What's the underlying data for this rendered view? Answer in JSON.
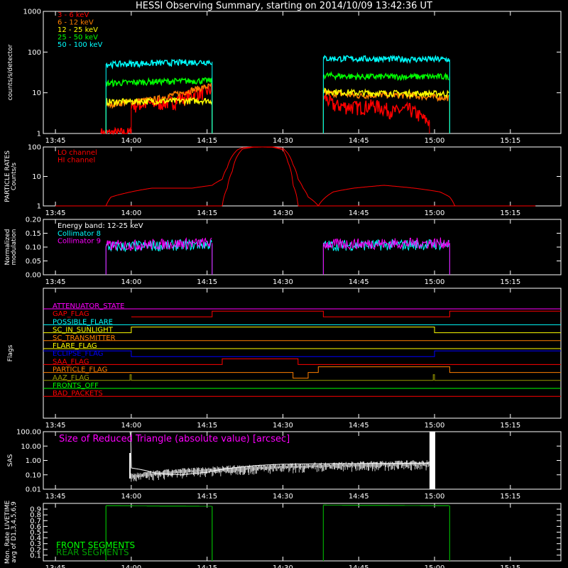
{
  "title": "HESSI Observing Summary, starting on 2014/10/09 13:42:36 UT",
  "colors": {
    "bg": "#000000",
    "axis": "#ffffff",
    "red": "#ff0000",
    "orange": "#ff7f00",
    "yellow": "#ffff00",
    "green": "#00ff00",
    "cyan": "#00ffff",
    "magenta": "#ff00ff",
    "blue": "#0000ff",
    "olive": "#9a9a00",
    "darkgreen": "#00a000",
    "white": "#ffffff"
  },
  "chart_data": [
    {
      "type": "line",
      "ylabel": "counts/s/detector",
      "yscale": "log",
      "ylim": [
        1,
        1000
      ],
      "yticks": [
        "1",
        "10",
        "100",
        "1000"
      ],
      "xlim": [
        "13:42:36",
        "15:25"
      ],
      "xticks": [
        "13:45",
        "14:00",
        "14:15",
        "14:30",
        "14:45",
        "15:00",
        "15:15"
      ],
      "series": [
        {
          "name": "3 - 6 keV",
          "color": "#ff0000",
          "segments": [
            {
              "x": [
                "13:54",
                "14:00"
              ],
              "y": [
                1,
                1
              ]
            },
            {
              "x": [
                "14:00",
                "14:04",
                "14:08",
                "14:12",
                "14:16"
              ],
              "y": [
                5,
                5.5,
                6,
                9,
                12
              ]
            },
            {
              "x": [
                "14:38",
                "14:40",
                "14:45",
                "14:48",
                "14:52",
                "14:55",
                "14:58",
                "14:59"
              ],
              "y": [
                8,
                5,
                4.5,
                5,
                3.5,
                4,
                2.2,
                2
              ]
            }
          ]
        },
        {
          "name": "6 - 12 keV",
          "color": "#ff7f00",
          "segments": [
            {
              "x": [
                "13:55",
                "14:05",
                "14:10",
                "14:16"
              ],
              "y": [
                5,
                7,
                10,
                15
              ]
            },
            {
              "x": [
                "14:38",
                "14:45",
                "14:50",
                "15:03"
              ],
              "y": [
                10,
                8.5,
                9,
                7.5
              ]
            }
          ]
        },
        {
          "name": "12 - 25 keV",
          "color": "#ffff00",
          "segments": [
            {
              "x": [
                "13:55",
                "14:16"
              ],
              "y": [
                6,
                6.5
              ]
            },
            {
              "x": [
                "14:38",
                "14:45",
                "15:03"
              ],
              "y": [
                11,
                10,
                9.5
              ]
            }
          ]
        },
        {
          "name": "25 - 50 keV",
          "color": "#00ff00",
          "segments": [
            {
              "x": [
                "13:55",
                "14:05",
                "14:16"
              ],
              "y": [
                17,
                19,
                20
              ]
            },
            {
              "x": [
                "14:38",
                "14:45",
                "15:03"
              ],
              "y": [
                27,
                25,
                25
              ]
            }
          ]
        },
        {
          "name": "50 - 100 keV",
          "color": "#00ffff",
          "segments": [
            {
              "x": [
                "13:55",
                "14:16"
              ],
              "y": [
                50,
                58
              ]
            },
            {
              "x": [
                "14:38",
                "15:03"
              ],
              "y": [
                70,
                66
              ]
            }
          ]
        }
      ]
    },
    {
      "type": "line",
      "ylabel": "PARTICLE RATES Counts/s",
      "yscale": "log",
      "ylim": [
        1,
        100
      ],
      "yticks": [
        "1",
        "10",
        "100"
      ],
      "xticks": [
        "13:45",
        "14:00",
        "14:15",
        "14:30",
        "14:45",
        "15:00",
        "15:15"
      ],
      "series": [
        {
          "name": "LO channel",
          "color": "#ff0000",
          "x": [
            "13:45",
            "13:55",
            "13:56",
            "14:00",
            "14:04",
            "14:08",
            "14:12",
            "14:16",
            "14:18",
            "14:19",
            "14:20",
            "14:21",
            "14:22",
            "14:24",
            "14:26",
            "14:28",
            "14:30",
            "14:31",
            "14:32",
            "14:33",
            "14:34",
            "14:35",
            "14:37",
            "14:40",
            "14:44",
            "14:50",
            "14:56",
            "15:01",
            "15:03",
            "15:04",
            "15:20"
          ],
          "y": [
            1,
            1,
            2,
            3,
            4,
            4,
            4,
            5,
            8,
            20,
            50,
            80,
            95,
            100,
            100,
            100,
            90,
            60,
            25,
            8,
            4,
            2,
            1,
            3,
            4,
            5,
            4,
            3,
            2,
            1,
            1
          ]
        },
        {
          "name": "HI channel",
          "color": "#ff0000",
          "x": [
            "13:45",
            "14:18",
            "14:19",
            "14:20",
            "14:21",
            "14:22",
            "14:24",
            "14:26",
            "14:28",
            "14:30",
            "14:31",
            "14:32",
            "14:33",
            "15:20"
          ],
          "y": [
            1,
            1,
            4,
            15,
            50,
            85,
            98,
            100,
            98,
            80,
            30,
            5,
            1,
            1
          ]
        }
      ]
    },
    {
      "type": "line",
      "ylabel": "Normalized modulation",
      "ylim": [
        0,
        0.2
      ],
      "yticks": [
        "0.00",
        "0.05",
        "0.10",
        "0.15",
        "0.20"
      ],
      "xticks": [
        "13:45",
        "14:00",
        "14:15",
        "14:30",
        "14:45",
        "15:00",
        "15:15"
      ],
      "annotation": "Energy band: 12-25 keV",
      "series": [
        {
          "name": "Collimator 8",
          "color": "#00ffff",
          "segments": [
            {
              "x": [
                "13:55",
                "14:16"
              ],
              "y": [
                0.1,
                0.11
              ]
            },
            {
              "x": [
                "14:38",
                "15:03"
              ],
              "y": [
                0.105,
                0.11
              ]
            }
          ]
        },
        {
          "name": "Collimator 9",
          "color": "#ff00ff",
          "segments": [
            {
              "x": [
                "13:55",
                "14:16"
              ],
              "y": [
                0.105,
                0.115
              ]
            },
            {
              "x": [
                "14:38",
                "15:03"
              ],
              "y": [
                0.11,
                0.115
              ]
            }
          ]
        }
      ]
    },
    {
      "type": "flags",
      "ylabel": "Flags",
      "xticks": [
        "13:45",
        "14:00",
        "14:15",
        "14:30",
        "14:45",
        "15:00",
        "15:15"
      ],
      "flags": [
        {
          "name": "ATTENUATOR_STATE",
          "color": "#ff00ff",
          "steps": []
        },
        {
          "name": "GAP_FLAG",
          "color": "#ff0000",
          "steps": [
            [
              "14:00",
              "14:16",
              0
            ],
            [
              "14:16",
              "14:38",
              1
            ],
            [
              "14:38",
              "15:03",
              0
            ],
            [
              "15:03",
              "15:25",
              1
            ]
          ]
        },
        {
          "name": "POSSIBLE_FLARE",
          "color": "#00ffff",
          "steps": []
        },
        {
          "name": "SC_IN_SUNLIGHT",
          "color": "#ffff00",
          "steps": [
            [
              "13:42:36",
              "14:00",
              0
            ],
            [
              "14:00",
              "15:00",
              1
            ],
            [
              "15:00",
              "15:25",
              0
            ]
          ]
        },
        {
          "name": "SC_TRANSMITTER",
          "color": "#ff7f00",
          "steps": []
        },
        {
          "name": "FLARE_FLAG",
          "color": "#ffff00",
          "steps": []
        },
        {
          "name": "ECLIPSE_FLAG",
          "color": "#0000ff",
          "steps": [
            [
              "13:42:36",
              "14:00",
              1
            ],
            [
              "14:00",
              "15:00",
              0
            ],
            [
              "15:00",
              "15:25",
              1
            ]
          ]
        },
        {
          "name": "SAA_FLAG",
          "color": "#ff0000",
          "steps": [
            [
              "13:42:36",
              "14:18",
              0
            ],
            [
              "14:18",
              "14:33",
              1
            ],
            [
              "14:33",
              "15:25",
              0
            ]
          ]
        },
        {
          "name": "PARTICLE_FLAG",
          "color": "#ff7f00",
          "steps": [
            [
              "13:42:36",
              "14:32",
              0
            ],
            [
              "14:32",
              "14:35",
              -1
            ],
            [
              "14:35",
              "14:37",
              0
            ],
            [
              "14:37",
              "15:03",
              1
            ],
            [
              "15:03",
              "15:25",
              0
            ]
          ]
        },
        {
          "name": "AAZ_FLAG",
          "color": "#9a9a00",
          "steps": [
            [
              "13:42:36",
              "13:59:45",
              0
            ],
            [
              "13:59:45",
              "14:00",
              1
            ],
            [
              "14:00",
              "14:59:45",
              0
            ],
            [
              "14:59:45",
              "15:00",
              1
            ],
            [
              "15:00",
              "15:25",
              0
            ]
          ]
        },
        {
          "name": "FRONTS_OFF",
          "color": "#00ff00",
          "steps": []
        },
        {
          "name": "BAD_PACKETS",
          "color": "#ff0000",
          "steps": []
        }
      ]
    },
    {
      "type": "line",
      "ylabel": "SAS",
      "yscale": "log",
      "ylim": [
        0.01,
        100
      ],
      "yticks": [
        "0.01",
        "0.10",
        "1.00",
        "10.00",
        "100.00"
      ],
      "xticks": [
        "13:45",
        "14:00",
        "14:15",
        "14:30",
        "14:45",
        "15:00",
        "15:15"
      ],
      "annotation": "Size of Reduced Triangle (absolute value) [arcsec]",
      "series": [
        {
          "name": "SAS triangle",
          "color": "#ffffff",
          "x": [
            "13:59:45",
            "14:00",
            "14:05",
            "14:10",
            "14:15",
            "14:20",
            "14:25",
            "14:30",
            "14:40",
            "14:50",
            "14:59"
          ],
          "y": [
            100,
            0.3,
            0.12,
            0.1,
            0.15,
            0.3,
            0.45,
            0.55,
            0.6,
            0.62,
            0.65
          ]
        }
      ]
    },
    {
      "type": "line",
      "ylabel": "Mon. Rate LIVETIME avg of D1,3,4,5,6,9",
      "ylim": [
        0,
        1
      ],
      "yticks": [
        "0.1",
        "0.2",
        "0.3",
        "0.4",
        "0.5",
        "0.6",
        "0.7",
        "0.8",
        "0.9"
      ],
      "xticks": [
        "13:45",
        "14:00",
        "14:15",
        "14:30",
        "14:45",
        "15:00",
        "15:15"
      ],
      "series": [
        {
          "name": "FRONT SEGMENTS",
          "color": "#00ff00",
          "segments": [
            {
              "x": [
                "13:55",
                "14:16"
              ],
              "y": [
                0.96,
                0.95
              ]
            },
            {
              "x": [
                "14:38",
                "15:03"
              ],
              "y": [
                0.97,
                0.96
              ]
            }
          ]
        },
        {
          "name": "REAR SEGMENTS",
          "color": "#00a000",
          "segments": [
            {
              "x": [
                "13:55",
                "14:16"
              ],
              "y": [
                0.96,
                0.95
              ]
            },
            {
              "x": [
                "14:38",
                "15:03"
              ],
              "y": [
                0.97,
                0.96
              ]
            }
          ]
        }
      ]
    }
  ]
}
